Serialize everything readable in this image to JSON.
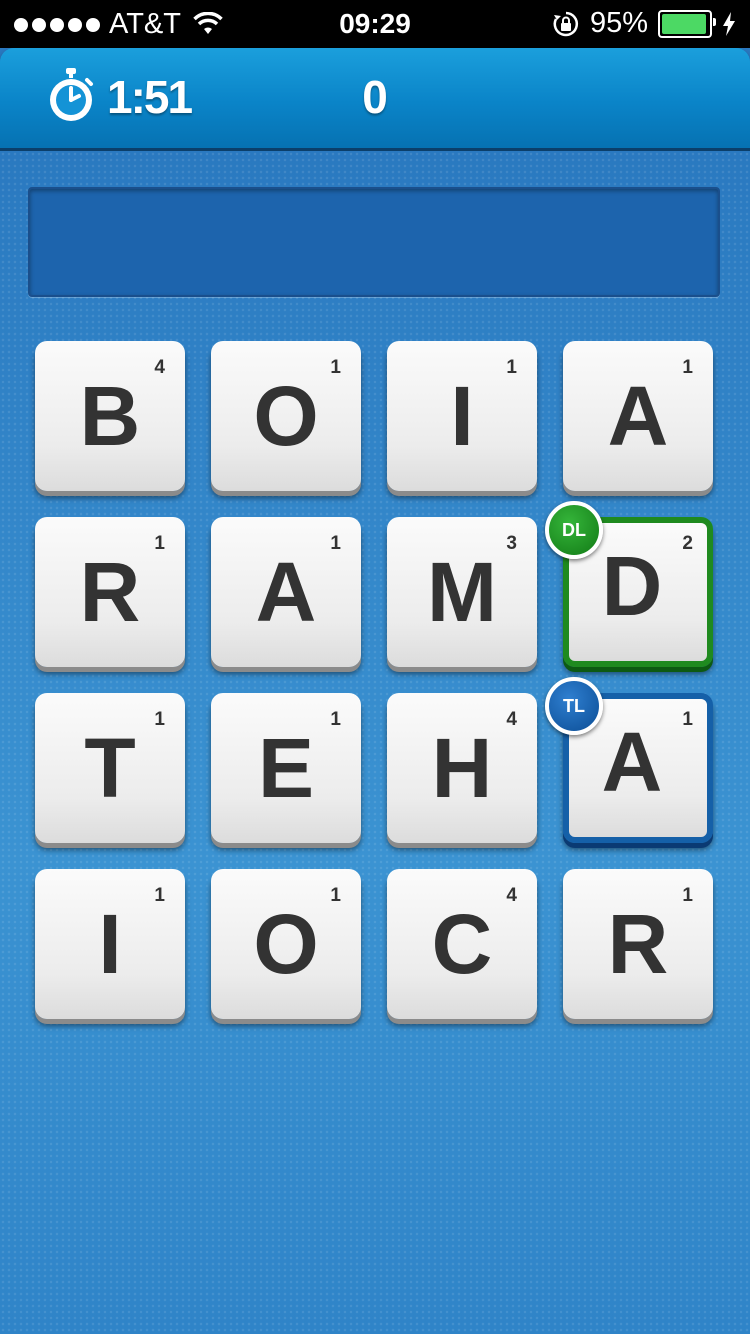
{
  "status": {
    "carrier": "AT&T",
    "time": "09:29",
    "battery": "95%",
    "battery_level": 0.95
  },
  "header": {
    "timer": "1:51",
    "score": "0"
  },
  "word": {
    "current": ""
  },
  "tiles": [
    {
      "letter": "B",
      "points": "4"
    },
    {
      "letter": "O",
      "points": "1"
    },
    {
      "letter": "I",
      "points": "1"
    },
    {
      "letter": "A",
      "points": "1"
    },
    {
      "letter": "R",
      "points": "1"
    },
    {
      "letter": "A",
      "points": "1"
    },
    {
      "letter": "M",
      "points": "3"
    },
    {
      "letter": "D",
      "points": "2",
      "bonus": "DL"
    },
    {
      "letter": "T",
      "points": "1"
    },
    {
      "letter": "E",
      "points": "1"
    },
    {
      "letter": "H",
      "points": "4"
    },
    {
      "letter": "A",
      "points": "1",
      "bonus": "TL"
    },
    {
      "letter": "I",
      "points": "1"
    },
    {
      "letter": "O",
      "points": "1"
    },
    {
      "letter": "C",
      "points": "4"
    },
    {
      "letter": "R",
      "points": "1"
    }
  ],
  "colors": {
    "dl": "#1f8a1f",
    "tl": "#1560a8",
    "header": "#0a84c8",
    "board": "#3286c9"
  }
}
